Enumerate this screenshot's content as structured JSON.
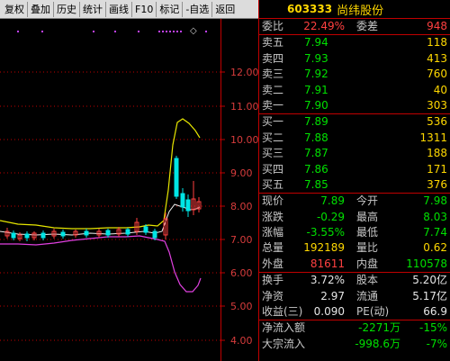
{
  "toolbar": {
    "buttons": [
      "复权",
      "叠加",
      "历史",
      "统计",
      "画线",
      "F10",
      "标记",
      "-自选",
      "返回"
    ]
  },
  "chart": {
    "y_ticks": [
      "12.00",
      "11.00",
      "10.00",
      "9.00",
      "8.00",
      "7.00",
      "6.00",
      "5.00",
      "4.00"
    ]
  },
  "quote": {
    "code": "603333",
    "name": "尚纬股份",
    "ratio": {
      "label": "委比",
      "value": "22.49%",
      "diff_label": "委差",
      "diff_value": "948"
    },
    "asks": [
      {
        "label": "卖五",
        "price": "7.94",
        "volume": "118"
      },
      {
        "label": "卖四",
        "price": "7.93",
        "volume": "413"
      },
      {
        "label": "卖三",
        "price": "7.92",
        "volume": "760"
      },
      {
        "label": "卖二",
        "price": "7.91",
        "volume": "40"
      },
      {
        "label": "卖一",
        "price": "7.90",
        "volume": "303"
      }
    ],
    "bids": [
      {
        "label": "买一",
        "price": "7.89",
        "volume": "536"
      },
      {
        "label": "买二",
        "price": "7.88",
        "volume": "1311"
      },
      {
        "label": "买三",
        "price": "7.87",
        "volume": "188"
      },
      {
        "label": "买四",
        "price": "7.86",
        "volume": "171"
      },
      {
        "label": "买五",
        "price": "7.85",
        "volume": "376"
      }
    ],
    "stats": [
      {
        "l1": "现价",
        "v1": "7.89",
        "l2": "今开",
        "v2": "7.98"
      },
      {
        "l1": "涨跌",
        "v1": "-0.29",
        "l2": "最高",
        "v2": "8.03"
      },
      {
        "l1": "涨幅",
        "v1": "-3.55%",
        "l2": "最低",
        "v2": "7.74"
      },
      {
        "l1": "总量",
        "v1": "192189",
        "l2": "量比",
        "v2": "0.62"
      },
      {
        "l1": "外盘",
        "v1": "81611",
        "l2": "内盘",
        "v2": "110578"
      }
    ],
    "finance": [
      {
        "l1": "换手",
        "v1": "3.72%",
        "l2": "股本",
        "v2": "5.20亿"
      },
      {
        "l1": "净资",
        "v1": "2.97",
        "l2": "流通",
        "v2": "5.17亿"
      },
      {
        "l1": "收益(三)",
        "v1": "0.090",
        "l2": "PE(动)",
        "v2": "66.9"
      }
    ],
    "flows": [
      {
        "label": "净流入额",
        "value": "-2271万",
        "pct": "-15%"
      },
      {
        "label": "大宗流入",
        "value": "-998.6万",
        "pct": "-7%"
      }
    ]
  }
}
